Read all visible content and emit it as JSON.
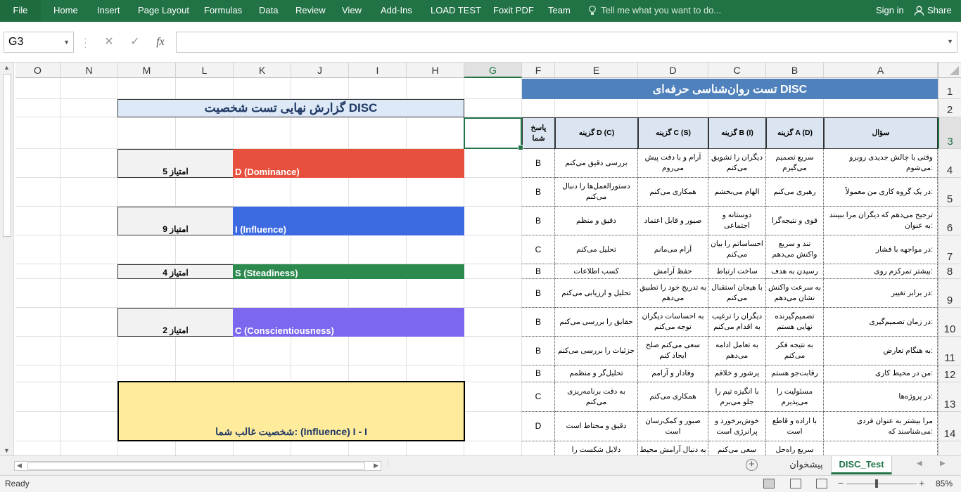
{
  "ribbon": {
    "file": "File",
    "tabs": [
      "Home",
      "Insert",
      "Page Layout",
      "Formulas",
      "Data",
      "Review",
      "View",
      "Add-Ins",
      "LOAD TEST",
      "Foxit PDF",
      "Team"
    ],
    "tell_me": "Tell me what you want to do...",
    "sign_in": "Sign in",
    "share": "Share"
  },
  "formula_bar": {
    "name_box": "G3",
    "cancel": "✕",
    "enter": "✓",
    "fx": "fx",
    "value": ""
  },
  "columns": [
    "O",
    "N",
    "M",
    "L",
    "K",
    "J",
    "I",
    "H",
    "G",
    "F",
    "E",
    "D",
    "C",
    "B",
    "A"
  ],
  "selected_column": "G",
  "rows": [
    "1",
    "2",
    "3",
    "4",
    "5",
    "6",
    "7",
    "8",
    "9",
    "10",
    "11",
    "12",
    "13",
    "14"
  ],
  "selected_row": "3",
  "test_title": "تست روان‌شناسی حرفه‌ای DISC",
  "table_headers": {
    "question": "سؤال",
    "option_a": "گزینه A (D)",
    "option_b": "گزینه B (I)",
    "option_c": "گزینه C (S)",
    "option_d": "گزینه D (C)",
    "answer": "پاسخ شما"
  },
  "table_rows": [
    {
      "q": "وقتی با چالش جدیدی روبرو می‌شوم:",
      "a": "سریع تصمیم می‌گیرم",
      "b": "دیگران را تشویق می‌کنم",
      "c": "آرام و با دقت پیش می‌روم",
      "d": "بررسی دقیق می‌کنم",
      "ans": "B"
    },
    {
      "q": "در یک گروه کاری من معمولاً:",
      "a": "رهبری می‌کنم",
      "b": "الهام می‌بخشم",
      "c": "همکاری می‌کنم",
      "d": "دستورالعمل‌ها را دنبال می‌کنم",
      "ans": "B"
    },
    {
      "q": "ترجیح می‌دهم که دیگران مرا ببینند به عنوان:",
      "a": "قوی و نتیجه‌گرا",
      "b": "دوستانه و اجتماعی",
      "c": "صبور و قابل اعتماد",
      "d": "دقیق و منظم",
      "ans": "B"
    },
    {
      "q": "در مواجهه با فشار:",
      "a": "تند و سریع واکنش می‌دهم",
      "b": "احساساتم را بیان می‌کنم",
      "c": "آرام می‌مانم",
      "d": "تحلیل می‌کنم",
      "ans": "C"
    },
    {
      "q": "بیشتر تمرکزم روی:",
      "a": "رسیدن به هدف",
      "b": "ساخت ارتباط",
      "c": "حفظ آرامش",
      "d": "کسب اطلاعات",
      "ans": "B"
    },
    {
      "q": "در برابر تغییر:",
      "a": "به سرعت واکنش نشان می‌دهم",
      "b": "با هیجان استقبال می‌کنم",
      "c": "به تدریج خود را تطبیق می‌دهم",
      "d": "تحلیل و ارزیابی می‌کنم",
      "ans": "B"
    },
    {
      "q": "در زمان تصمیم‌گیری:",
      "a": "تصمیم‌گیرنده نهایی هستم",
      "b": "دیگران را ترغیب به اقدام می‌کنم",
      "c": "به احساسات دیگران توجه می‌کنم",
      "d": "حقایق را بررسی می‌کنم",
      "ans": "B"
    },
    {
      "q": "به هنگام تعارض:",
      "a": "به نتیجه فکر می‌کنم",
      "b": "به تعامل ادامه می‌دهم",
      "c": "سعی می‌کنم صلح ایجاد کنم",
      "d": "جزئیات را بررسی می‌کنم",
      "ans": "B"
    },
    {
      "q": "من در محیط کاری:",
      "a": "رقابت‌جو هستم",
      "b": "پرشور و خلاقم",
      "c": "وفادار و آرامم",
      "d": "تحلیل‌گر و منظمم",
      "ans": "B"
    },
    {
      "q": "در پروژه‌ها:",
      "a": "مسئولیت را می‌پذیرم",
      "b": "با انگیزه تیم را جلو می‌برم",
      "c": "همکاری می‌کنم",
      "d": "به دقت برنامه‌ریزی می‌کنم",
      "ans": "C"
    },
    {
      "q": "مرا بیشتر به عنوان فردی می‌شناسند که:",
      "a": "با اراده و قاطع است",
      "b": "خوش‌برخورد و پرانرژی است",
      "c": "صبور و کمک‌رسان است",
      "d": "دقیق و محتاط است",
      "ans": "D"
    },
    {
      "q": "",
      "a": "سریع راه‌حل",
      "b": "سعی می‌کنم",
      "c": "به دنبال آرامش محیط",
      "d": "دلایل شکست را",
      "ans": ""
    }
  ],
  "report_title": "گزارش نهایی تست شخصیت DISC",
  "scores": [
    {
      "label": "D (Dominance)",
      "score_text": "امتیاز 5",
      "score": 5,
      "color": "#e8503e"
    },
    {
      "label": "I (Influence)",
      "score_text": "امتیاز 9",
      "score": 9,
      "color": "#3c6ae0"
    },
    {
      "label": "S (Steadiness)",
      "score_text": "امتیاز 4",
      "score": 4,
      "color": "#2d8a4e"
    },
    {
      "label": "C (Conscientiousness)",
      "score_text": "امتیاز 2",
      "score": 2,
      "color": "#7b68ee"
    }
  ],
  "dominant_text": "شخصیت غالب شما: (Influence) I - I",
  "sheets": [
    "پیشخوان",
    "DISC_Test"
  ],
  "active_sheet": "DISC_Test",
  "status": {
    "ready": "Ready",
    "zoom": "85%"
  }
}
